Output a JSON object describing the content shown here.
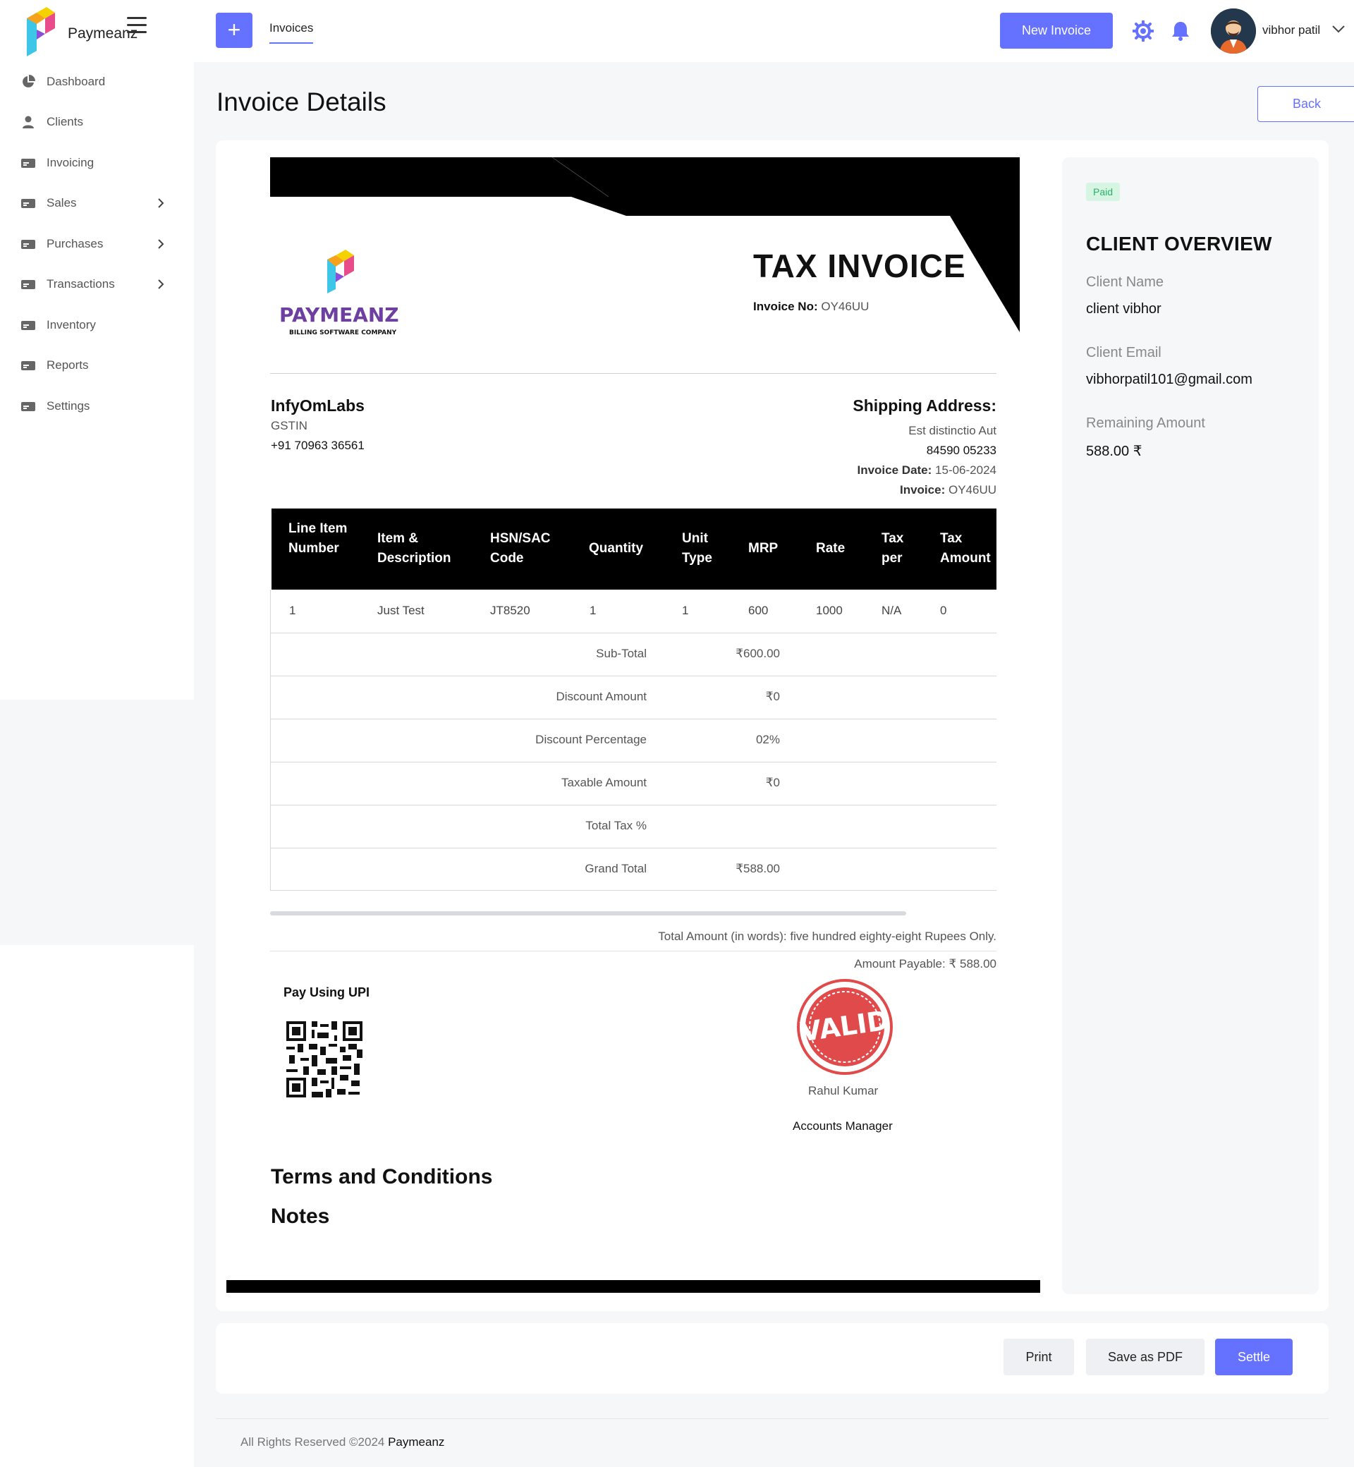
{
  "app": {
    "brand": "Paymeanz"
  },
  "header": {
    "tab": "Invoices",
    "new_invoice": "New Invoice",
    "user_name": "vibhor patil"
  },
  "sidebar": {
    "items": [
      {
        "label": "Dashboard",
        "icon": "pie-chart-icon"
      },
      {
        "label": "Clients",
        "icon": "user-icon"
      },
      {
        "label": "Invoicing",
        "icon": "card-icon"
      },
      {
        "label": "Sales",
        "icon": "card-icon",
        "has_submenu": true
      },
      {
        "label": "Purchases",
        "icon": "card-icon",
        "has_submenu": true
      },
      {
        "label": "Transactions",
        "icon": "card-icon",
        "has_submenu": true
      },
      {
        "label": "Inventory",
        "icon": "card-icon"
      },
      {
        "label": "Reports",
        "icon": "card-icon"
      },
      {
        "label": "Settings",
        "icon": "card-icon"
      }
    ]
  },
  "page": {
    "title": "Invoice Details",
    "back": "Back"
  },
  "invoice": {
    "logo_text": "PAYMEANZ",
    "logo_subtext": "BILLING SOFTWARE COMPANY",
    "title": "TAX INVOICE",
    "invoice_no_label": "Invoice No:",
    "invoice_no": "OY46UU",
    "company": {
      "name": "InfyOmLabs",
      "gstin": "GSTIN",
      "phone": "+91 70963 36561"
    },
    "shipping": {
      "title": "Shipping Address:",
      "line1": "Est distinctio Aut",
      "line2": "84590 05233",
      "date_label": "Invoice Date:",
      "date": "15-06-2024",
      "invoice_label": "Invoice:",
      "invoice": "OY46UU"
    },
    "table": {
      "headers": [
        "Line Item Number",
        "Item & Description",
        "HSN/SAC Code",
        "Quantity",
        "Unit Type",
        "MRP",
        "Rate",
        "Tax per",
        "Tax Amount"
      ],
      "rows": [
        [
          "1",
          "Just Test",
          "JT8520",
          "1",
          "1",
          "600",
          "1000",
          "N/A",
          "0"
        ]
      ]
    },
    "summary": [
      {
        "label": "Sub-Total",
        "value": "₹600.00"
      },
      {
        "label": "Discount Amount",
        "value": "₹0"
      },
      {
        "label": "Discount Percentage",
        "value": "02%"
      },
      {
        "label": "Taxable Amount",
        "value": "₹0"
      },
      {
        "label": "Total Tax %",
        "value": ""
      },
      {
        "label": "Grand Total",
        "value": "₹588.00"
      }
    ],
    "amount_in_words": "Total Amount (in words): five hundred eighty-eight Rupees Only.",
    "amount_payable": "Amount Payable: ₹ 588.00",
    "pay_upi": "Pay Using UPI",
    "stamp_text": "VALID",
    "signer": "Rahul Kumar",
    "signer_role": "Accounts Manager",
    "terms": "Terms and Conditions",
    "notes": "Notes"
  },
  "client_overview": {
    "status": "Paid",
    "title": "CLIENT OVERVIEW",
    "name_label": "Client Name",
    "name": "client vibhor",
    "email_label": "Client Email",
    "email": "vibhorpatil101@gmail.com",
    "remaining_label": "Remaining Amount",
    "remaining": "588.00 ₹"
  },
  "actions": {
    "print": "Print",
    "pdf": "Save as PDF",
    "settle": "Settle"
  },
  "footer": {
    "copyright": "All Rights Reserved ©2024",
    "brand": "Paymeanz"
  },
  "colors": {
    "accent": "#6571ff",
    "paid_bg": "#d6f5e3",
    "paid_text": "#2ab26a"
  }
}
